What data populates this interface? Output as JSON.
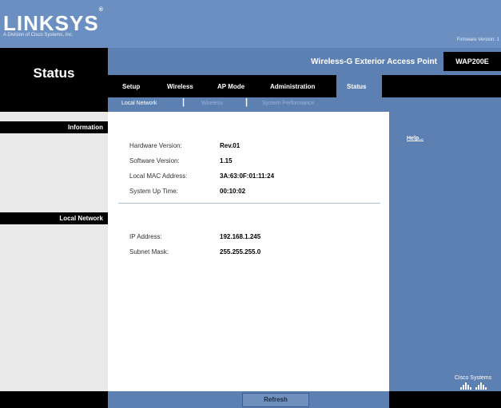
{
  "brand": {
    "logo": "LINKSYS",
    "sub": "A Division of Cisco Systems, Inc.",
    "firmware": "Firmware Version: 1"
  },
  "page_title": "Status",
  "product": {
    "name": "Wireless-G Exterior Access Point",
    "model": "WAP200E"
  },
  "nav": {
    "items": [
      "Setup",
      "Wireless",
      "AP Mode",
      "Administration",
      "Status"
    ],
    "active": "Status"
  },
  "subnav": {
    "items": [
      "Local Network",
      "Wireless",
      "System Performance"
    ],
    "active": "Local Network"
  },
  "sections": {
    "information": "Information",
    "local_network": "Local Network"
  },
  "information": {
    "rows": [
      {
        "label": "Hardware Version:",
        "value": "Rev.01"
      },
      {
        "label": "Software Version:",
        "value": "1.15"
      },
      {
        "label": "Local MAC Address:",
        "value": "3A:63:0F:01:11:24"
      },
      {
        "label": "System Up Time:",
        "value": "00:10:02"
      }
    ]
  },
  "local_network": {
    "rows": [
      {
        "label": "IP Address:",
        "value": "192.168.1.245"
      },
      {
        "label": "Subnet Mask:",
        "value": "255.255.255.0"
      }
    ]
  },
  "help_link": "Help...",
  "refresh_label": "Refresh",
  "cisco_logo_text": "Cisco Systems",
  "colors": {
    "header": "#6a8fc0",
    "blue": "#5c80b2",
    "black": "#000000",
    "gray": "#e9e9e9"
  }
}
